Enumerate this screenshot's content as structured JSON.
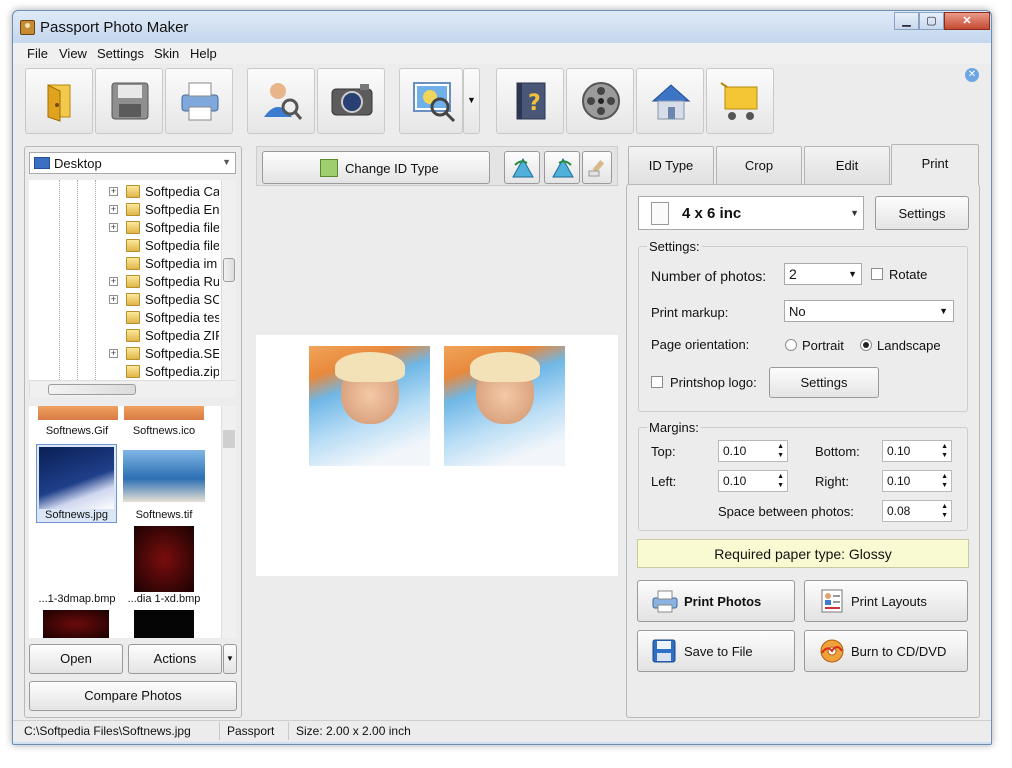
{
  "window": {
    "title": "Passport Photo Maker"
  },
  "menu": [
    "File",
    "View",
    "Settings",
    "Skin",
    "Help"
  ],
  "toolbar": {
    "icons": [
      "open-icon",
      "save-icon",
      "print-icon",
      "user-search-icon",
      "camera-icon",
      "picture-zoom-icon",
      "help-book-icon",
      "film-reel-icon",
      "home-icon",
      "shopping-cart-icon"
    ]
  },
  "browser": {
    "location": "Desktop",
    "tree_items": [
      "Softpedia Ca",
      "Softpedia En",
      "Softpedia file",
      "Softpedia file",
      "Softpedia im",
      "Softpedia Ru",
      "Softpedia SC",
      "Softpedia tes",
      "Softpedia ZIP",
      "Softpedia.SE",
      "Softpedia.zip"
    ],
    "files": [
      "Softnews.Gif",
      "Softnews.ico",
      "Softnews.jpg",
      "Softnews.tif",
      "...1-3dmap.bmp",
      "...dia 1-xd.bmp"
    ],
    "open_label": "Open",
    "actions_label": "Actions",
    "compare_label": "Compare Photos"
  },
  "center": {
    "change_id_label": "Change ID Type"
  },
  "tabs": [
    "ID Type",
    "Crop",
    "Edit",
    "Print"
  ],
  "print": {
    "paper_size": "4 x 6 inc",
    "settings_button": "Settings",
    "settings_group": "Settings:",
    "num_photos_label": "Number of photos:",
    "num_photos_value": "2",
    "rotate_label": "Rotate",
    "markup_label": "Print markup:",
    "markup_value": "No",
    "orientation_label": "Page orientation:",
    "portrait_label": "Portrait",
    "landscape_label": "Landscape",
    "printshop_label": "Printshop logo:",
    "printshop_settings": "Settings",
    "margins_group": "Margins:",
    "top_label": "Top:",
    "top_value": "0.10",
    "bottom_label": "Bottom:",
    "bottom_value": "0.10",
    "left_label": "Left:",
    "left_value": "0.10",
    "right_label": "Right:",
    "right_value": "0.10",
    "space_label": "Space between photos:",
    "space_value": "0.08",
    "paper_type": "Required paper type: Glossy",
    "print_photos": "Print Photos",
    "print_layouts": "Print Layouts",
    "save_to_file": "Save to File",
    "burn": "Burn to CD/DVD"
  },
  "status": {
    "path": "C:\\Softpedia Files\\Softnews.jpg",
    "type": "Passport",
    "size": "Size: 2.00 x 2.00 inch"
  },
  "colors": {
    "accent": "#6ea6e4",
    "paper_bar": "#fafad2"
  }
}
